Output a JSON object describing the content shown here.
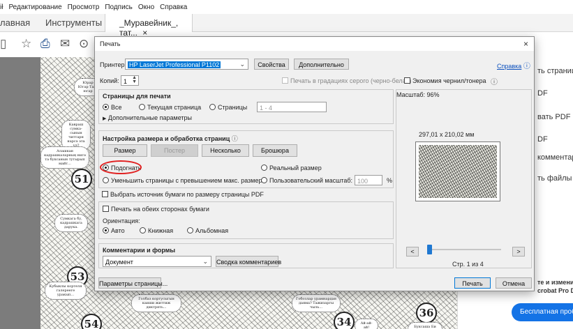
{
  "menubar": {
    "items": [
      "ił",
      "Редактирование",
      "Просмотр",
      "Подпись",
      "Окно",
      "Справка"
    ]
  },
  "tabbar": {
    "home": "лавная",
    "tools": "Инструменты",
    "doc_tab": "_Муравейник_, тат...",
    "doc_close": "×"
  },
  "toolbar": {
    "icons": [
      "bookmark-icon",
      "star-icon",
      "print-icon",
      "mail-icon",
      "search-icon"
    ]
  },
  "background_doc": {
    "badges": [
      "51",
      "53",
      "54",
      "34",
      "36"
    ],
    "bubbles": [
      "Юрар Югар Тагр югар",
      "Кавраш сумка- сынын читтарн нарсэ эта ул?",
      "Алашкан кадрашкаларның нигә та буксанын тутырып майт...",
      "Сумкага бу, кадрашкага дарука.",
      "Кубыклы кортеля галерееге уракып...",
      "Голбаз кортусыгын каиши життиж диктрять...",
      "Гобозлар урамнардан даяма? Тажизаргы чыль...",
      "Ай-ай-ай!",
      "Буксаша Би сыннии ту..."
    ]
  },
  "right_panel": {
    "items": [
      "ть страницу\"",
      "DF",
      "вать PDF",
      "DF",
      "комментар",
      "ть файлы",
      "те и измени",
      "crobat Pro D"
    ],
    "trial_button": "Бесплатная пробная"
  },
  "dialog": {
    "title": "Печать",
    "close": "×",
    "printer_label": "Принтер:",
    "printer_value": "HP LaserJet Professional P1102",
    "properties_button": "Свойства",
    "advanced_button": "Дополнительно",
    "help_link": "Справка",
    "copies_label": "Копий:",
    "copies_value": "1",
    "grayscale_label": "Печать в градациях серого (черно-белая)",
    "ink_saver_label": "Экономия чернил/тонера",
    "pages_section_title": "Страницы для печати",
    "radio_all": "Все",
    "radio_current": "Текущая страница",
    "radio_pages": "Страницы",
    "pages_range_placeholder": "1 - 4",
    "more_options": "Дополнительные параметры",
    "sizing_section_title": "Настройка размера и обработка страниц",
    "tab_size": "Размер",
    "tab_poster": "Постер",
    "tab_multiple": "Несколько",
    "tab_booklet": "Брошюра",
    "radio_fit": "Подогнать",
    "radio_actual": "Реальный размер",
    "radio_shrink": "Уменьшить страницы с превышением макс. размера",
    "radio_custom_scale": "Пользовательский масштаб:",
    "custom_scale_value": "100",
    "percent": "%",
    "choose_paper_label": "Выбрать источник бумаги по размеру страницы PDF",
    "both_sides_label": "Печать на обеих сторонах бумаги",
    "orientation_label": "Ориентация:",
    "radio_auto": "Авто",
    "radio_portrait": "Книжная",
    "radio_landscape": "Альбомная",
    "comments_section_title": "Комментарии и формы",
    "comments_value": "Документ",
    "summarize_button": "Сводка комментариев",
    "scale_label": "Масштаб: 96%",
    "preview_size": "297,01 x 210,02 мм",
    "prev_button": "<",
    "next_button": ">",
    "page_counter": "Стр. 1 из 4",
    "page_setup_button": "Параметры страницы...",
    "print_button": "Печать",
    "cancel_button": "Отмена",
    "preview_page_position": 0.0
  }
}
